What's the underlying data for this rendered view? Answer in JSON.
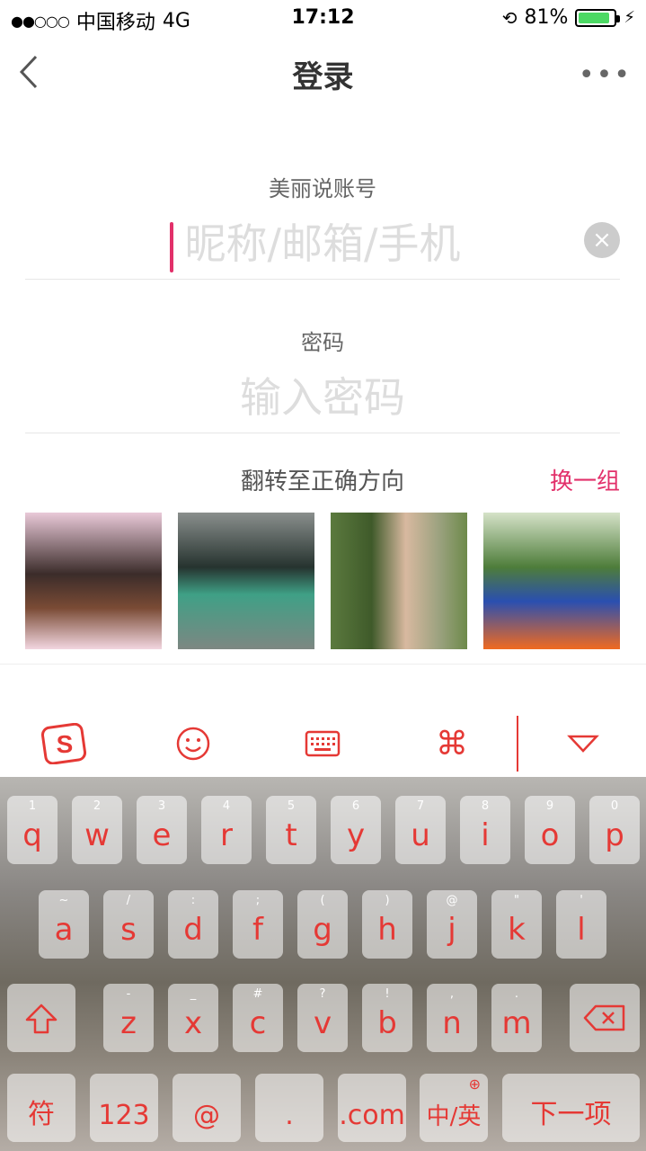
{
  "status_bar": {
    "carrier": "中国移动",
    "network": "4G",
    "time": "17:12",
    "battery": "81%",
    "battery_level": 0.81
  },
  "nav": {
    "title": "登录",
    "back_icon": "chevron-left-icon",
    "more_icon": "more-dots-icon"
  },
  "form": {
    "account_label": "美丽说账号",
    "account_placeholder": "昵称/邮箱/手机",
    "password_label": "密码",
    "password_placeholder": "输入密码"
  },
  "captcha": {
    "label": "翻转至正确方向",
    "swap_label": "换一组"
  },
  "toolbar": {
    "icons": [
      "sogou-logo-icon",
      "emoji-icon",
      "keyboard-icon",
      "command-icon",
      "collapse-icon"
    ]
  },
  "keyboard": {
    "row1": [
      [
        "q",
        "1"
      ],
      [
        "w",
        "2"
      ],
      [
        "e",
        "3"
      ],
      [
        "r",
        "4"
      ],
      [
        "t",
        "5"
      ],
      [
        "y",
        "6"
      ],
      [
        "u",
        "7"
      ],
      [
        "i",
        "8"
      ],
      [
        "o",
        "9"
      ],
      [
        "p",
        "0"
      ]
    ],
    "row2": [
      [
        "a",
        "~"
      ],
      [
        "s",
        "/"
      ],
      [
        "d",
        ":"
      ],
      [
        "f",
        ";"
      ],
      [
        "g",
        "("
      ],
      [
        "h",
        ")"
      ],
      [
        "j",
        "@"
      ],
      [
        "k",
        "\""
      ],
      [
        "l",
        "'"
      ]
    ],
    "row3": [
      [
        "z",
        "-"
      ],
      [
        "x",
        "_"
      ],
      [
        "c",
        "#"
      ],
      [
        "v",
        "?"
      ],
      [
        "b",
        "!"
      ],
      [
        "n",
        ","
      ],
      [
        "m",
        "."
      ]
    ],
    "row4": {
      "symbol": "符",
      "num": "123",
      "at": "@",
      "dot": ".",
      "com": ".com",
      "lang": "中/英",
      "next": "下一项"
    }
  },
  "colors": {
    "accent": "#e2306a",
    "key_text": "#e53935"
  }
}
